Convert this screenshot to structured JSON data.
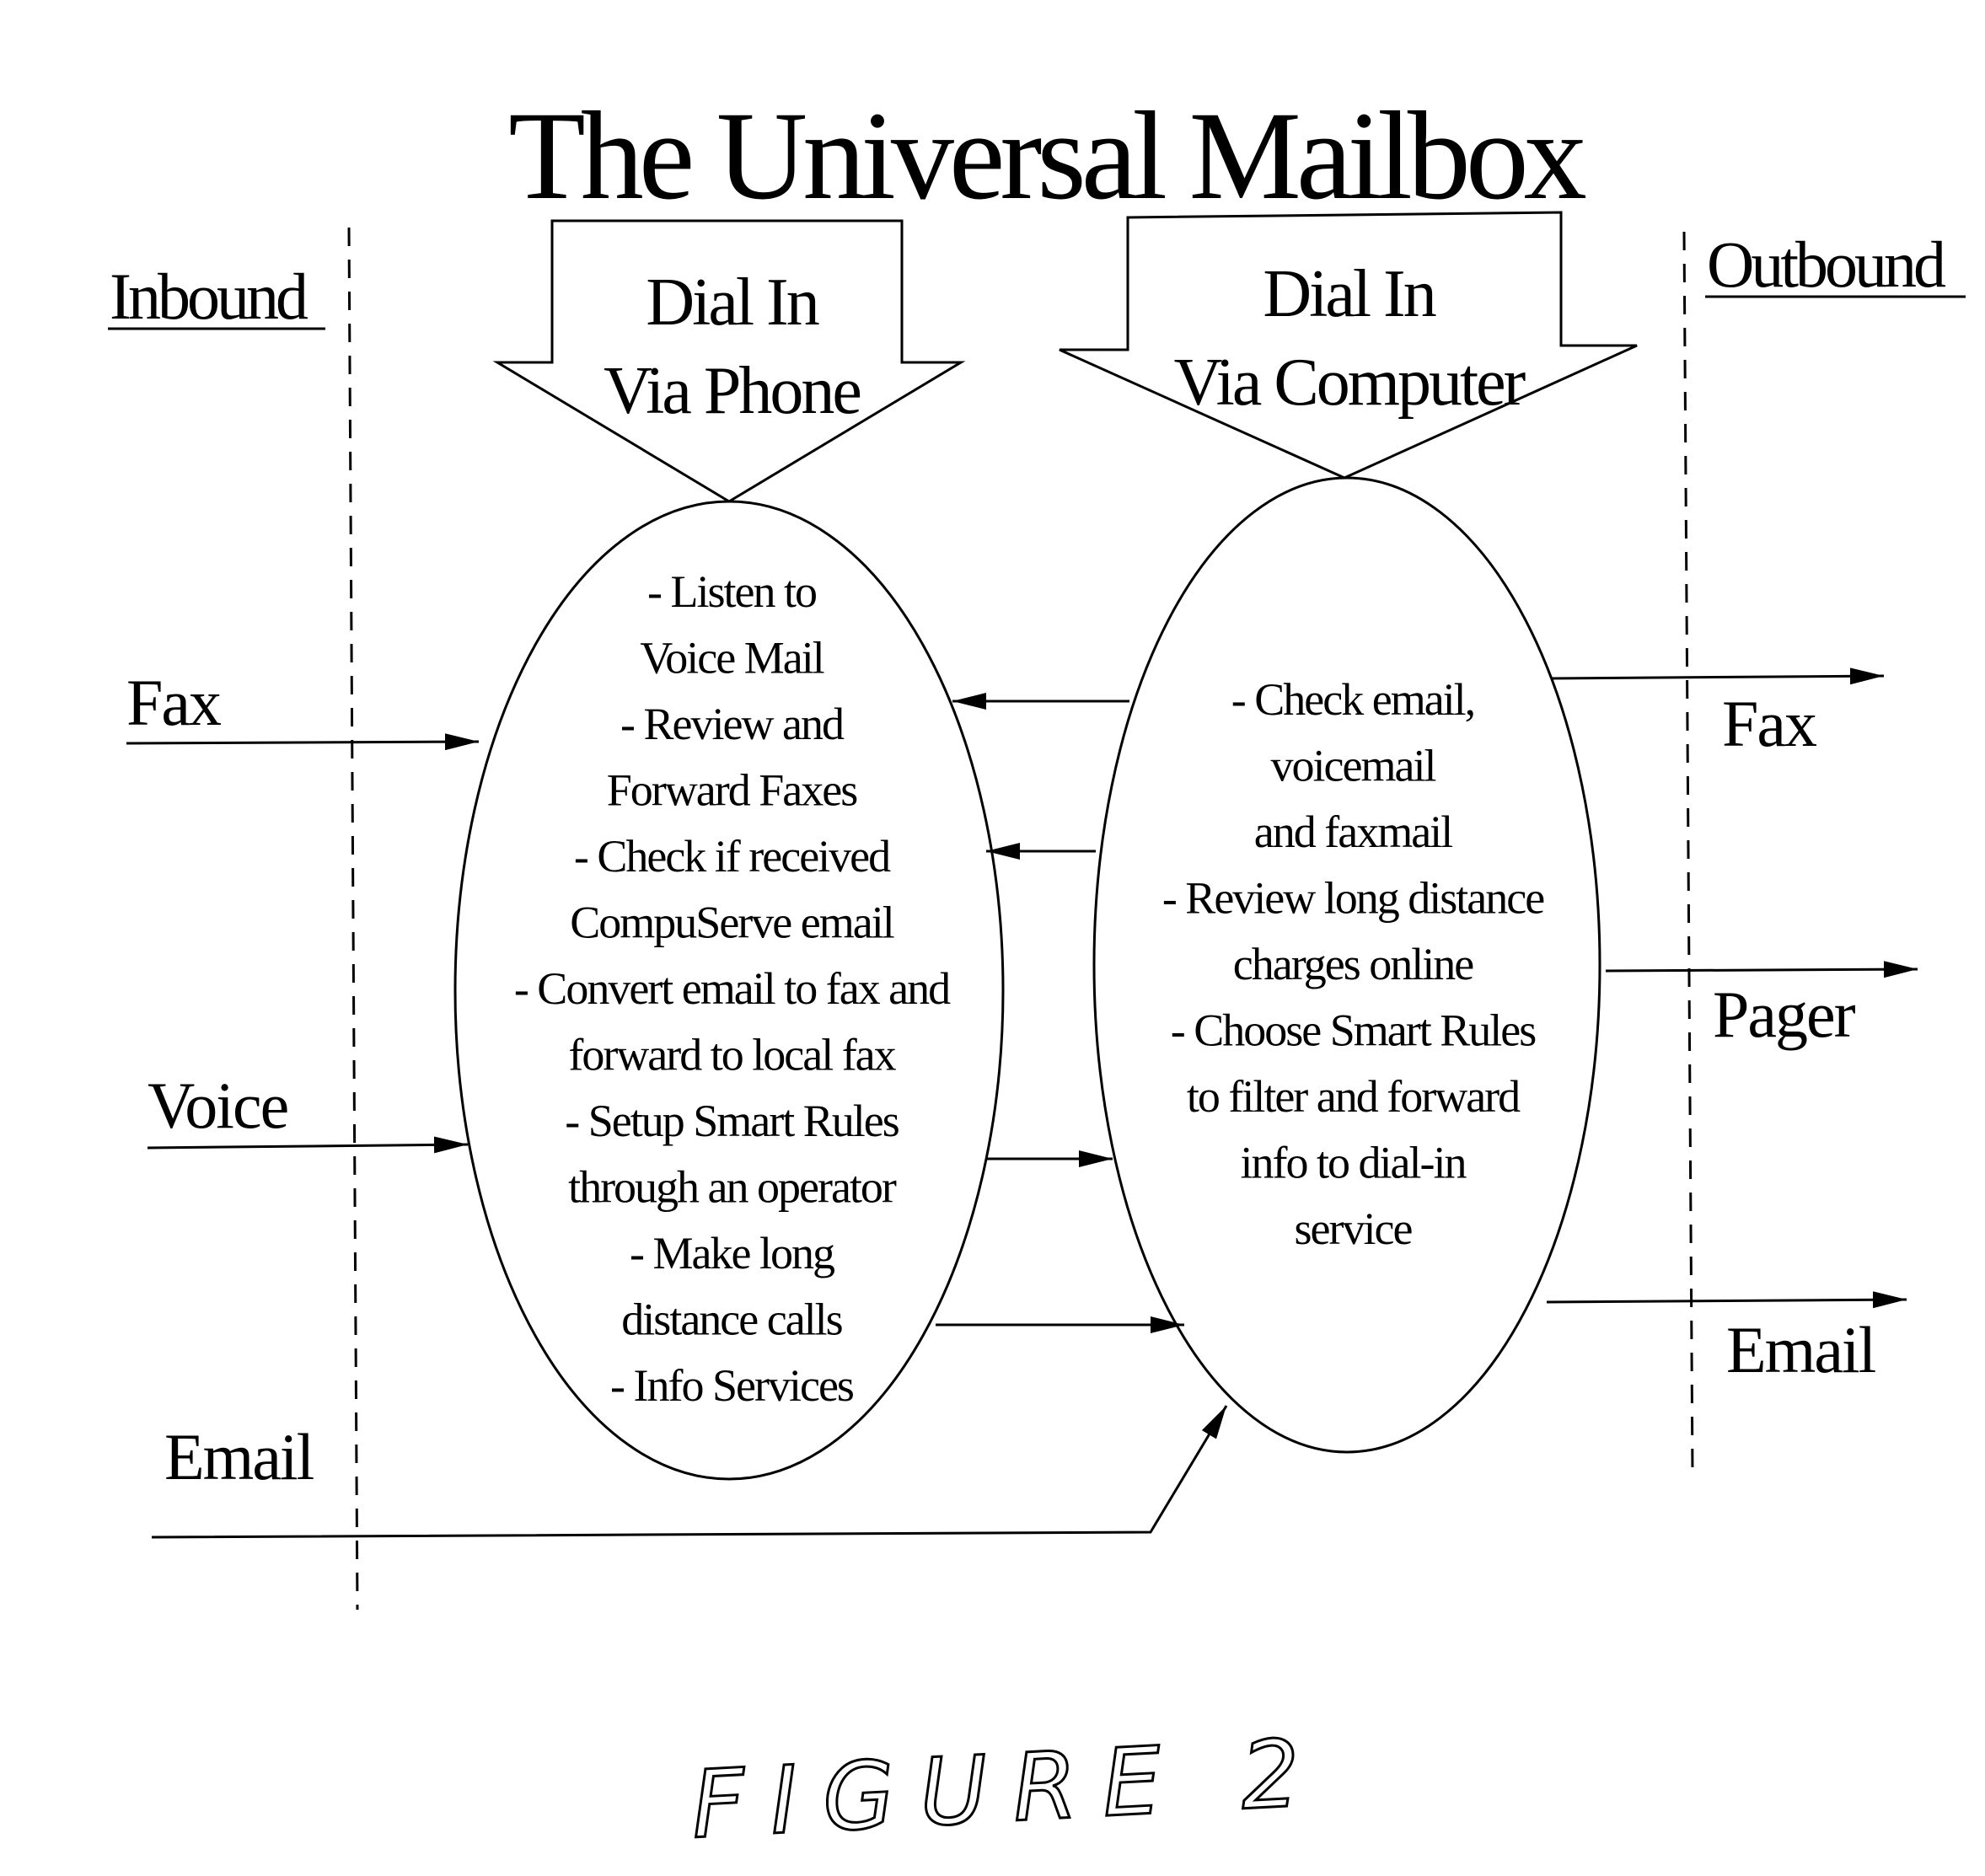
{
  "title": "The Universal Mailbox",
  "sections": {
    "inbound": "Inbound",
    "outbound": "Outbound"
  },
  "dial_in_phone": {
    "line1": "Dial In",
    "line2": "Via Phone",
    "features": [
      "- Listen to",
      "Voice Mail",
      "- Review and",
      "Forward Faxes",
      "- Check if received",
      "CompuServe email",
      "- Convert email to fax and",
      "forward to local fax",
      "- Setup Smart Rules",
      "through an operator",
      "- Make long",
      "distance calls",
      "- Info Services"
    ]
  },
  "dial_in_computer": {
    "line1": "Dial In",
    "line2": "Via Computer",
    "features": [
      "- Check email,",
      "voicemail",
      "and faxmail",
      "- Review long distance",
      "charges online",
      "- Choose Smart Rules",
      "to filter and forward",
      "info to dial-in",
      "service"
    ]
  },
  "inbound_items": [
    "Fax",
    "Voice",
    "Email"
  ],
  "outbound_items": [
    "Fax",
    "Pager",
    "Email"
  ],
  "caption": "FIGURE 2"
}
